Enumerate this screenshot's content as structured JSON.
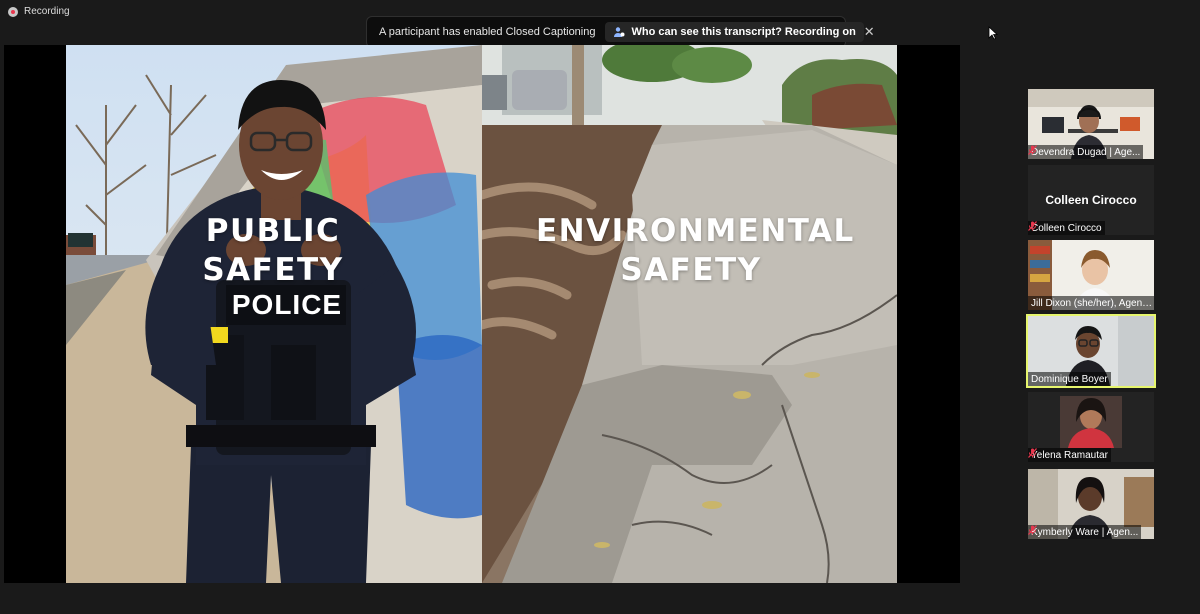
{
  "recording": {
    "label": "Recording"
  },
  "banner": {
    "message": "A participant has enabled Closed Captioning",
    "transcript_link": "Who can see this transcript? Recording on",
    "close_glyph": "✕"
  },
  "slide": {
    "left_title": "PUBLIC\nSAFETY",
    "right_title": "ENVIRONMENTAL\nSAFETY",
    "police_patch": "POLICE"
  },
  "participants": [
    {
      "name": "Devendra Dugad | Age...",
      "muted": true,
      "video": true
    },
    {
      "name": "Colleen Cirocco",
      "center_name": "Colleen Cirocco",
      "muted": true,
      "video": false
    },
    {
      "name": "Jill Dixon (she/her), Agenc...",
      "muted": false,
      "video": true
    },
    {
      "name": "Dominique Boyer",
      "muted": false,
      "video": true,
      "active": true
    },
    {
      "name": "Yelena Ramautar",
      "muted": true,
      "video": true
    },
    {
      "name": "Kymberly Ware | Agen...",
      "muted": true,
      "video": true
    }
  ],
  "colors": {
    "active_speaker": "#e6f56d",
    "muted_icon": "#e8384f",
    "recording_dot": "#e8384f"
  }
}
